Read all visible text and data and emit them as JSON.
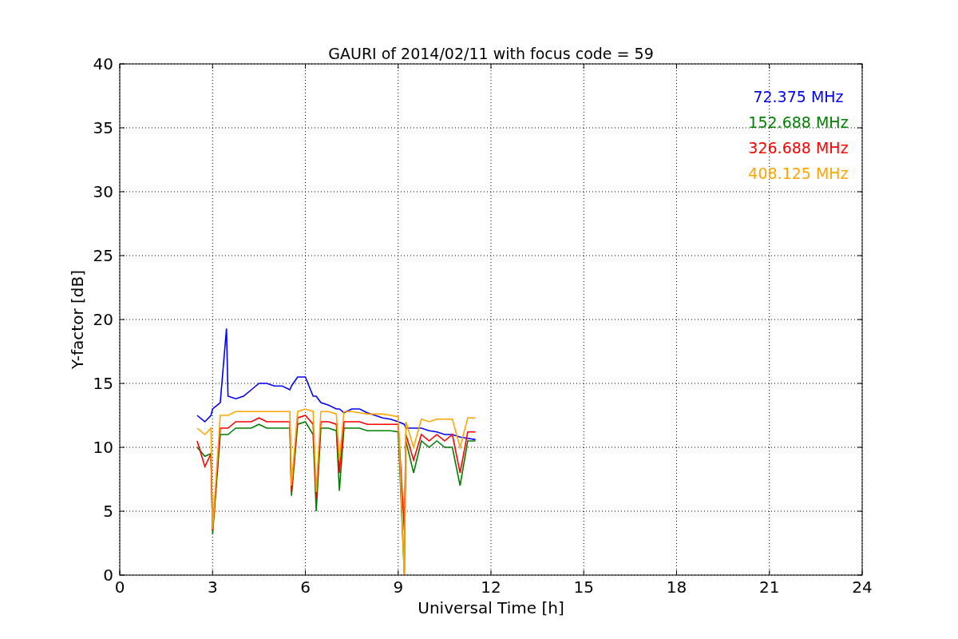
{
  "figure": {
    "chart_data": {
      "type": "line",
      "title": "GAURI of 2014/02/11 with focus code = 59",
      "xlabel": "Universal Time [h]",
      "ylabel": "Y-factor [dB]",
      "x": [
        2.5,
        2.75,
        2.95,
        3.0,
        3.25,
        3.45,
        3.5,
        3.75,
        4.0,
        4.25,
        4.5,
        4.75,
        5.0,
        5.25,
        5.5,
        5.55,
        5.75,
        6.0,
        6.25,
        6.35,
        6.5,
        6.75,
        7.0,
        7.1,
        7.25,
        7.5,
        7.75,
        8.0,
        8.25,
        8.5,
        8.75,
        9.0,
        9.2,
        9.25,
        9.5,
        9.75,
        10.0,
        10.25,
        10.5,
        10.75,
        11.0,
        11.25,
        11.5
      ],
      "series": [
        {
          "name": "72.375 MHz",
          "color": "#0000ff",
          "values": [
            12.5,
            12,
            12.5,
            13,
            13.5,
            19.3,
            14,
            13.8,
            14,
            14.5,
            15,
            15,
            14.8,
            14.8,
            14.5,
            14.8,
            15.5,
            15.5,
            14,
            14,
            13.5,
            13.3,
            13,
            13,
            12.7,
            13,
            13,
            12.7,
            12.5,
            12.3,
            12.2,
            12,
            11.8,
            11.5,
            11.5,
            11.5,
            11.3,
            11.2,
            11,
            11,
            10.8,
            10.7,
            10.6
          ]
        },
        {
          "name": "152.688 MHz",
          "color": "#008000",
          "values": [
            10,
            9.3,
            9.5,
            3.2,
            11,
            11,
            11,
            11.5,
            11.5,
            11.5,
            11.8,
            11.5,
            11.5,
            11.5,
            11.5,
            6.2,
            11.8,
            12,
            11,
            5,
            11.5,
            11.5,
            11.3,
            6.6,
            11.5,
            11.5,
            11.5,
            11.3,
            11.3,
            11.3,
            11.3,
            11.2,
            0,
            10.5,
            8,
            10.5,
            10,
            10.5,
            10,
            10,
            7,
            10.5,
            10.5
          ]
        },
        {
          "name": "326.688 MHz",
          "color": "#ff0000",
          "values": [
            10.5,
            8.5,
            9.5,
            3.5,
            11.5,
            11.5,
            11.5,
            12,
            12,
            12,
            12.3,
            12,
            12,
            12,
            12,
            6.5,
            12.3,
            12.5,
            11.8,
            6,
            12,
            12,
            11.8,
            8,
            12,
            12,
            12,
            11.8,
            11.8,
            11.8,
            11.8,
            11.8,
            3.5,
            11,
            9,
            11,
            10.5,
            11,
            10.5,
            11,
            8,
            11.2,
            11.2
          ]
        },
        {
          "name": "408.125 MHz",
          "color": "#ffa500",
          "values": [
            11.5,
            11,
            11.5,
            3.6,
            12.5,
            12.5,
            12.5,
            12.8,
            12.8,
            12.8,
            12.8,
            12.8,
            12.8,
            12.8,
            12.8,
            7,
            12.8,
            13,
            12.8,
            6.5,
            12.8,
            12.8,
            12.6,
            9,
            12.8,
            12.8,
            12.7,
            12.6,
            12.6,
            12.6,
            12.5,
            12.4,
            0,
            12,
            10,
            12.2,
            12,
            12.2,
            12.2,
            12.2,
            10,
            12.3,
            12.3
          ]
        }
      ],
      "xlim": [
        0,
        24
      ],
      "ylim": [
        0,
        40
      ],
      "grid": true,
      "xticks": [
        0,
        3,
        6,
        9,
        12,
        15,
        18,
        21,
        24
      ],
      "yticks": [
        0,
        5,
        10,
        15,
        20,
        25,
        30,
        35,
        40
      ]
    }
  }
}
